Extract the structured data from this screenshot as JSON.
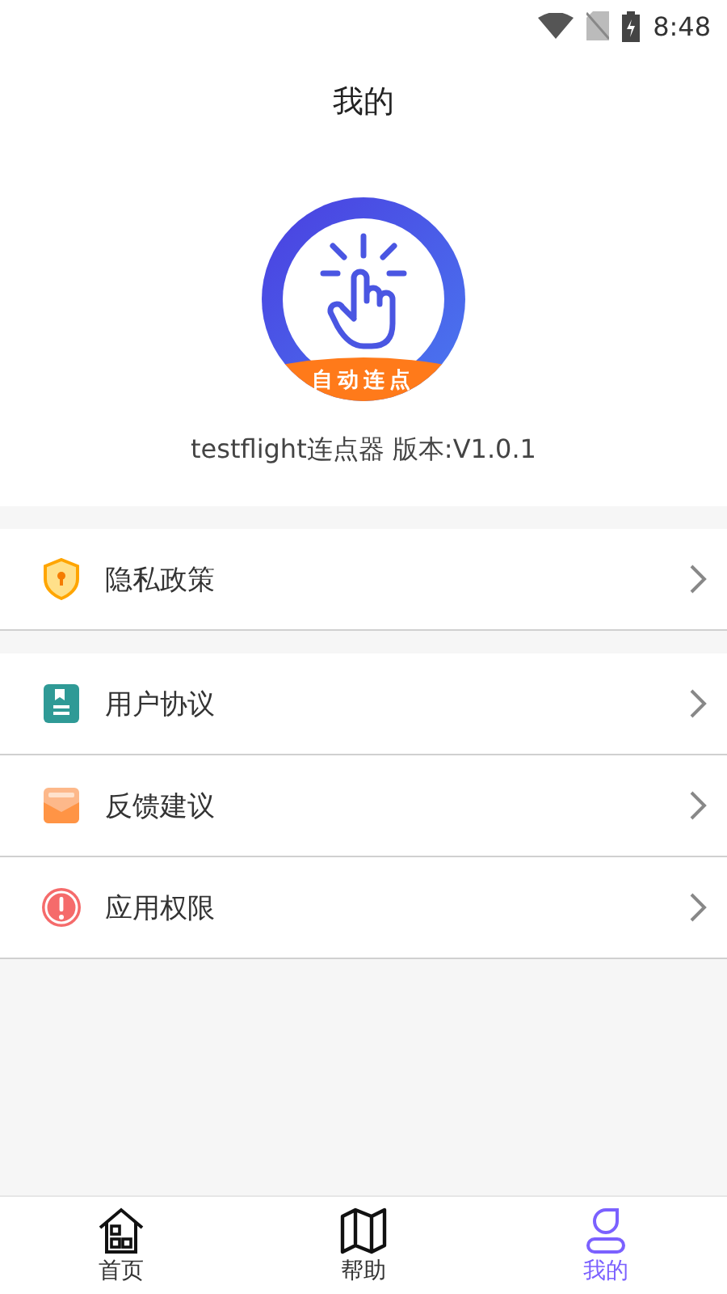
{
  "status_bar": {
    "time": "8:48"
  },
  "header": {
    "title": "我的"
  },
  "profile": {
    "logo_text": "自动连点",
    "version": "testflight连点器 版本:V1.0.1"
  },
  "menu_groups": [
    {
      "items": [
        {
          "label": "隐私政策"
        }
      ]
    },
    {
      "items": [
        {
          "label": "用户协议"
        },
        {
          "label": "反馈建议"
        },
        {
          "label": "应用权限"
        }
      ]
    }
  ],
  "tabs": [
    {
      "label": "首页",
      "selected": false
    },
    {
      "label": "帮助",
      "selected": false
    },
    {
      "label": "我的",
      "selected": true
    }
  ]
}
